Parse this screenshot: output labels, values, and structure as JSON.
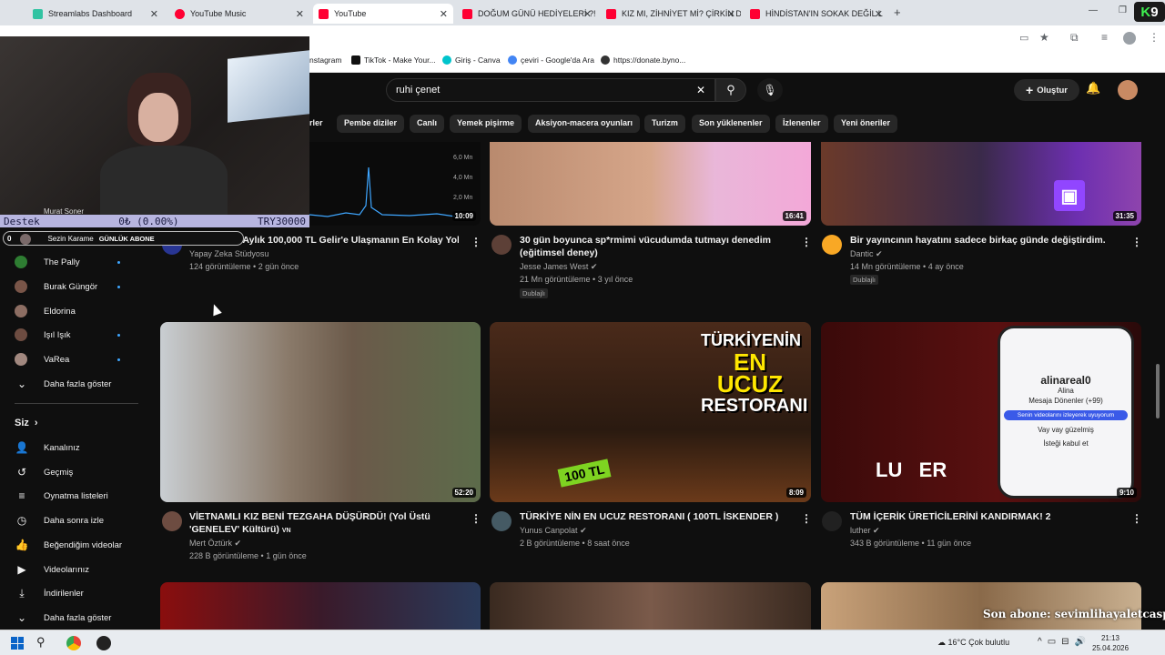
{
  "tabs": [
    {
      "label": "Streamlabs Dashboard",
      "color": "#31c3a2",
      "active": false
    },
    {
      "label": "YouTube Music",
      "color": "#ff0033",
      "active": false
    },
    {
      "label": "YouTube",
      "color": "#ff0033",
      "active": true
    },
    {
      "label": "DOĞUM GÜNÜ HEDİYELERİ ?!",
      "color": "#ff0033",
      "active": false
    },
    {
      "label": "KIZ MI, ZİHNİYET Mİ? ÇİRKİN D",
      "color": "#ff0033",
      "active": false
    },
    {
      "label": "HİNDİSTAN'IN SOKAK DEĞİL L",
      "color": "#ff0033",
      "active": false
    }
  ],
  "bookmarks": [
    {
      "label": "nstagram"
    },
    {
      "label": "TikTok - Make Your..."
    },
    {
      "label": "Giriş - Canva"
    },
    {
      "label": "çeviri - Google'da Ara"
    },
    {
      "label": "https://donate.byno..."
    }
  ],
  "header": {
    "search_value": "ruhi çenet",
    "create_label": "Oluştur"
  },
  "chips": [
    "rler",
    "Pembe diziler",
    "Canlı",
    "Yemek pişirme",
    "Aksiyon-macera oyunları",
    "Turizm",
    "Son yüklenenler",
    "İzlenenler",
    "Yeni öneriler"
  ],
  "stream_overlay": {
    "left": "Destek",
    "middle": "0₺ (0.00%)",
    "right": "TRY30000",
    "ticker_name": "Sezin Karame",
    "ticker_label": "GÜNLÜK ABONE",
    "ticker_prefix": "0",
    "partial_sub": "Murat Soner"
  },
  "subscriptions": [
    {
      "label": "The Pally",
      "color": "#2e7d32",
      "dot": true
    },
    {
      "label": "Burak Güngör",
      "color": "#795548",
      "dot": true
    },
    {
      "label": "Eldorina",
      "color": "#8d6e63",
      "dot": false
    },
    {
      "label": "Işıl Işık",
      "color": "#6d4c41",
      "dot": true
    },
    {
      "label": "VaRea",
      "color": "#a1887f",
      "dot": true
    }
  ],
  "sidebar": {
    "show_more": "Daha fazla göster",
    "you_label": "Siz",
    "items": [
      "Kanalınız",
      "Geçmiş",
      "Oynatma listeleri",
      "Daha sonra izle",
      "Beğendiğim videolar",
      "Videolarınız",
      "İndirilenler",
      "Daha fazla göster"
    ]
  },
  "row1": [
    {
      "title": "Youtube'da Aylık 100,000 TL Gelir'e Ulaşmanın En Kolay Yolu!",
      "channel": "Yapay Zeka Stüdyosu",
      "meta": "124 görüntüleme • 2 gün önce",
      "duration": "10:09",
      "verified": false,
      "badge": ""
    },
    {
      "title": "30 gün boyunca sp*rmimi vücudumda tutmayı denedim (eğitimsel deney)",
      "channel": "Jesse James West",
      "meta": "21 Mn görüntüleme • 3 yıl önce",
      "duration": "16:41",
      "verified": true,
      "badge": "Dublajlı"
    },
    {
      "title": "Bir yayıncının hayatını sadece birkaç günde değiştirdim.",
      "channel": "Dantic",
      "meta": "14 Mn görüntüleme • 4 ay önce",
      "duration": "31:35",
      "verified": true,
      "badge": "Dublajlı"
    }
  ],
  "chart_axis": [
    "6,0 Mn",
    "4,0 Mn",
    "2,0 Mn"
  ],
  "row2": [
    {
      "title": "VİETNAMLI KIZ BENİ TEZGAHA DÜŞÜRDÜ! (Yol Üstü 'GENELEV' Kültürü)",
      "channel": "Mert Öztürk",
      "meta": "228 B görüntüleme • 1 gün önce",
      "duration": "52:20",
      "verified": true,
      "suffix": "VN"
    },
    {
      "title": "TÜRKİYE NİN EN UCUZ RESTORANI ( 100TL İSKENDER )",
      "channel": "Yunus Canpolat",
      "meta": "2 B görüntüleme • 8 saat önce",
      "duration": "8:09",
      "verified": true,
      "suffix": ""
    },
    {
      "title": "TÜM İÇERİK ÜRETİCİLERİNİ KANDIRMAK! 2",
      "channel": "luther",
      "meta": "343 B görüntüleme • 11 gün önce",
      "duration": "9:10",
      "verified": true,
      "suffix": ""
    }
  ],
  "thumb_text": {
    "t2_line1": "TÜRKİYENİN",
    "t2_line2": "EN UCUZ",
    "t2_line3": "RESTORANI",
    "t2_price": "100 TL",
    "t3_name": "alinareal0",
    "t3_sub": "Alina",
    "t3_followers": "Mesaja Dönenler (+99)",
    "t3_msg1": "Senin videolarını izleyerek uyuyorum",
    "t3_msg2": "Vay vay güzelmiş",
    "t3_msg3": "İsteği kabul et",
    "t3_word": "LU   ER"
  },
  "stream_bottom": "Son abone: sevimlihayaletcasper",
  "stream_k": "9",
  "taskbar": {
    "weather": "16°C  Çok bulutlu",
    "time": "21:13",
    "date": "25.04.2026"
  }
}
